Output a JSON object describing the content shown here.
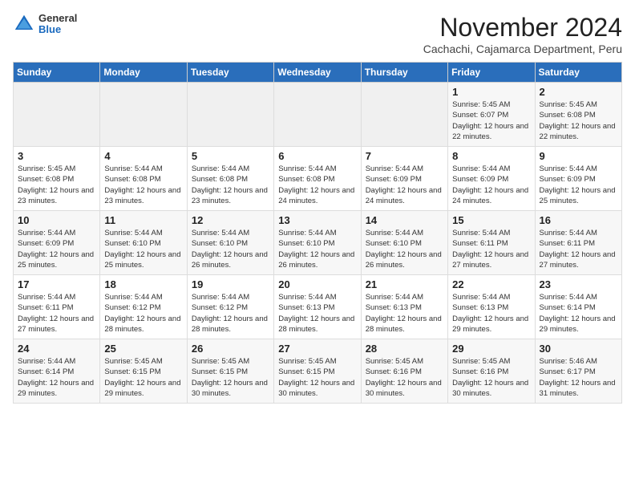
{
  "header": {
    "logo_general": "General",
    "logo_blue": "Blue",
    "month_title": "November 2024",
    "subtitle": "Cachachi, Cajamarca Department, Peru"
  },
  "weekdays": [
    "Sunday",
    "Monday",
    "Tuesday",
    "Wednesday",
    "Thursday",
    "Friday",
    "Saturday"
  ],
  "weeks": [
    [
      {
        "day": "",
        "info": ""
      },
      {
        "day": "",
        "info": ""
      },
      {
        "day": "",
        "info": ""
      },
      {
        "day": "",
        "info": ""
      },
      {
        "day": "",
        "info": ""
      },
      {
        "day": "1",
        "info": "Sunrise: 5:45 AM\nSunset: 6:07 PM\nDaylight: 12 hours and 22 minutes."
      },
      {
        "day": "2",
        "info": "Sunrise: 5:45 AM\nSunset: 6:08 PM\nDaylight: 12 hours and 22 minutes."
      }
    ],
    [
      {
        "day": "3",
        "info": "Sunrise: 5:45 AM\nSunset: 6:08 PM\nDaylight: 12 hours and 23 minutes."
      },
      {
        "day": "4",
        "info": "Sunrise: 5:44 AM\nSunset: 6:08 PM\nDaylight: 12 hours and 23 minutes."
      },
      {
        "day": "5",
        "info": "Sunrise: 5:44 AM\nSunset: 6:08 PM\nDaylight: 12 hours and 23 minutes."
      },
      {
        "day": "6",
        "info": "Sunrise: 5:44 AM\nSunset: 6:08 PM\nDaylight: 12 hours and 24 minutes."
      },
      {
        "day": "7",
        "info": "Sunrise: 5:44 AM\nSunset: 6:09 PM\nDaylight: 12 hours and 24 minutes."
      },
      {
        "day": "8",
        "info": "Sunrise: 5:44 AM\nSunset: 6:09 PM\nDaylight: 12 hours and 24 minutes."
      },
      {
        "day": "9",
        "info": "Sunrise: 5:44 AM\nSunset: 6:09 PM\nDaylight: 12 hours and 25 minutes."
      }
    ],
    [
      {
        "day": "10",
        "info": "Sunrise: 5:44 AM\nSunset: 6:09 PM\nDaylight: 12 hours and 25 minutes."
      },
      {
        "day": "11",
        "info": "Sunrise: 5:44 AM\nSunset: 6:10 PM\nDaylight: 12 hours and 25 minutes."
      },
      {
        "day": "12",
        "info": "Sunrise: 5:44 AM\nSunset: 6:10 PM\nDaylight: 12 hours and 26 minutes."
      },
      {
        "day": "13",
        "info": "Sunrise: 5:44 AM\nSunset: 6:10 PM\nDaylight: 12 hours and 26 minutes."
      },
      {
        "day": "14",
        "info": "Sunrise: 5:44 AM\nSunset: 6:10 PM\nDaylight: 12 hours and 26 minutes."
      },
      {
        "day": "15",
        "info": "Sunrise: 5:44 AM\nSunset: 6:11 PM\nDaylight: 12 hours and 27 minutes."
      },
      {
        "day": "16",
        "info": "Sunrise: 5:44 AM\nSunset: 6:11 PM\nDaylight: 12 hours and 27 minutes."
      }
    ],
    [
      {
        "day": "17",
        "info": "Sunrise: 5:44 AM\nSunset: 6:11 PM\nDaylight: 12 hours and 27 minutes."
      },
      {
        "day": "18",
        "info": "Sunrise: 5:44 AM\nSunset: 6:12 PM\nDaylight: 12 hours and 28 minutes."
      },
      {
        "day": "19",
        "info": "Sunrise: 5:44 AM\nSunset: 6:12 PM\nDaylight: 12 hours and 28 minutes."
      },
      {
        "day": "20",
        "info": "Sunrise: 5:44 AM\nSunset: 6:13 PM\nDaylight: 12 hours and 28 minutes."
      },
      {
        "day": "21",
        "info": "Sunrise: 5:44 AM\nSunset: 6:13 PM\nDaylight: 12 hours and 28 minutes."
      },
      {
        "day": "22",
        "info": "Sunrise: 5:44 AM\nSunset: 6:13 PM\nDaylight: 12 hours and 29 minutes."
      },
      {
        "day": "23",
        "info": "Sunrise: 5:44 AM\nSunset: 6:14 PM\nDaylight: 12 hours and 29 minutes."
      }
    ],
    [
      {
        "day": "24",
        "info": "Sunrise: 5:44 AM\nSunset: 6:14 PM\nDaylight: 12 hours and 29 minutes."
      },
      {
        "day": "25",
        "info": "Sunrise: 5:45 AM\nSunset: 6:15 PM\nDaylight: 12 hours and 29 minutes."
      },
      {
        "day": "26",
        "info": "Sunrise: 5:45 AM\nSunset: 6:15 PM\nDaylight: 12 hours and 30 minutes."
      },
      {
        "day": "27",
        "info": "Sunrise: 5:45 AM\nSunset: 6:15 PM\nDaylight: 12 hours and 30 minutes."
      },
      {
        "day": "28",
        "info": "Sunrise: 5:45 AM\nSunset: 6:16 PM\nDaylight: 12 hours and 30 minutes."
      },
      {
        "day": "29",
        "info": "Sunrise: 5:45 AM\nSunset: 6:16 PM\nDaylight: 12 hours and 30 minutes."
      },
      {
        "day": "30",
        "info": "Sunrise: 5:46 AM\nSunset: 6:17 PM\nDaylight: 12 hours and 31 minutes."
      }
    ]
  ]
}
